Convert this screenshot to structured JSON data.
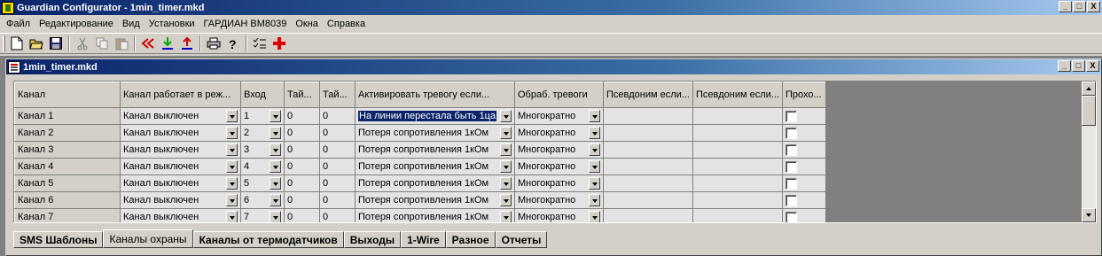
{
  "window": {
    "title": "Guardian Configurator - 1min_timer.mkd",
    "btn_min": "_",
    "btn_max": "□",
    "btn_close": "X"
  },
  "menu": [
    "Файл",
    "Редактирование",
    "Вид",
    "Установки",
    "ГАРДИАН ВМ8039",
    "Окна",
    "Справка"
  ],
  "child": {
    "title": "1min_timer.mkd",
    "btn_min": "_",
    "btn_max": "□",
    "btn_close": "X"
  },
  "grid": {
    "headers": [
      "Канал",
      "Канал работает в реж...",
      "Вход",
      "Тай...",
      "Тай...",
      "Активировать тревогу если...",
      "Обраб. тревоги",
      "Псевдоним если...",
      "Псевдоним если...",
      "Прохо..."
    ],
    "rows": [
      {
        "channel": "Канал 1",
        "mode": "Канал выключен",
        "input": "1",
        "t1": "0",
        "t2": "0",
        "activate": "На линии перестала быть 1ца",
        "processing": "Многократно",
        "alias1": "",
        "alias2": ""
      },
      {
        "channel": "Канал 2",
        "mode": "Канал выключен",
        "input": "2",
        "t1": "0",
        "t2": "0",
        "activate": "Потеря сопротивления 1кОм",
        "processing": "Многократно",
        "alias1": "",
        "alias2": ""
      },
      {
        "channel": "Канал 3",
        "mode": "Канал выключен",
        "input": "3",
        "t1": "0",
        "t2": "0",
        "activate": "Потеря сопротивления 1кОм",
        "processing": "Многократно",
        "alias1": "",
        "alias2": ""
      },
      {
        "channel": "Канал 4",
        "mode": "Канал выключен",
        "input": "4",
        "t1": "0",
        "t2": "0",
        "activate": "Потеря сопротивления 1кОм",
        "processing": "Многократно",
        "alias1": "",
        "alias2": ""
      },
      {
        "channel": "Канал 5",
        "mode": "Канал выключен",
        "input": "5",
        "t1": "0",
        "t2": "0",
        "activate": "Потеря сопротивления 1кОм",
        "processing": "Многократно",
        "alias1": "",
        "alias2": ""
      },
      {
        "channel": "Канал 6",
        "mode": "Канал выключен",
        "input": "6",
        "t1": "0",
        "t2": "0",
        "activate": "Потеря сопротивления 1кОм",
        "processing": "Многократно",
        "alias1": "",
        "alias2": ""
      },
      {
        "channel": "Канал 7",
        "mode": "Канал выключен",
        "input": "7",
        "t1": "0",
        "t2": "0",
        "activate": "Потеря сопротивления 1кОм",
        "processing": "Многократно",
        "alias1": "",
        "alias2": ""
      }
    ]
  },
  "tabs": [
    "SMS Шаблоны",
    "Каналы охраны",
    "Каналы от термодатчиков",
    "Выходы",
    "1-Wire",
    "Разное",
    "Отчеты"
  ],
  "active_tab": "Каналы охраны",
  "toolbar_icons": [
    "new-file-icon",
    "open-folder-icon",
    "save-icon",
    "cut-icon",
    "copy-icon",
    "paste-icon",
    "read-device-icon",
    "download-icon",
    "upload-icon",
    "print-icon",
    "help-icon",
    "checklist-icon",
    "red-cross-icon"
  ]
}
